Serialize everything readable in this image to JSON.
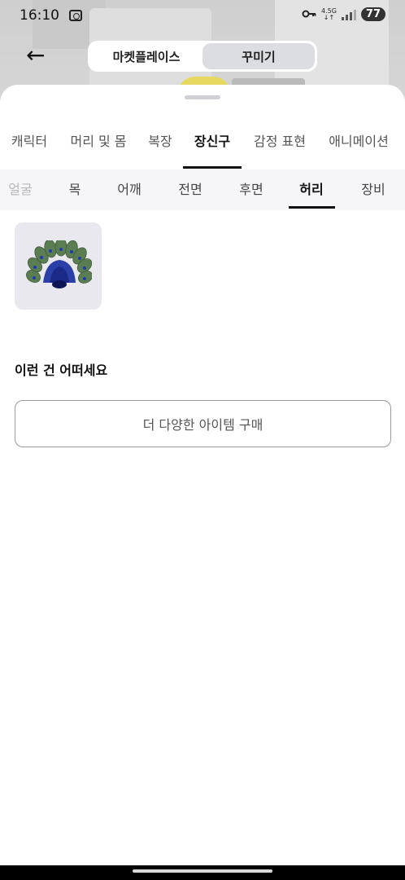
{
  "status_bar": {
    "time": "16:10",
    "network_top": "4.5G",
    "network_bottom": "↓↑",
    "battery": "77",
    "icons": [
      "screenshot-icon",
      "key-icon",
      "signal-icon"
    ]
  },
  "header": {
    "back_icon": "arrow-left-icon",
    "back_glyph": "←",
    "segments": [
      {
        "label": "마켓플레이스",
        "active": false
      },
      {
        "label": "꾸미기",
        "active": true
      }
    ]
  },
  "category_tabs": [
    {
      "label": "캐릭터",
      "active": false
    },
    {
      "label": "머리 및 몸",
      "active": false
    },
    {
      "label": "복장",
      "active": false
    },
    {
      "label": "장신구",
      "active": true
    },
    {
      "label": "감정 표현",
      "active": false
    },
    {
      "label": "애니메이션",
      "active": false
    }
  ],
  "sub_tabs": [
    {
      "label": "얼굴",
      "active": false
    },
    {
      "label": "목",
      "active": false
    },
    {
      "label": "어깨",
      "active": false
    },
    {
      "label": "전면",
      "active": false
    },
    {
      "label": "후면",
      "active": false
    },
    {
      "label": "허리",
      "active": true
    },
    {
      "label": "장비",
      "active": false
    }
  ],
  "items": [
    {
      "icon": "peacock-tail-icon"
    }
  ],
  "suggestion": {
    "title": "이런 건 어떠세요",
    "button_label": "더 다양한 아이템 구매"
  },
  "colors": {
    "sheet_bg": "#ffffff",
    "active_segment": "#dcdde3",
    "sub_tab_bg": "#f6f6f8",
    "item_card_bg": "#e8e8ee",
    "peacock_blue": "#1f3bb0",
    "peacock_green": "#4f7a4a"
  }
}
